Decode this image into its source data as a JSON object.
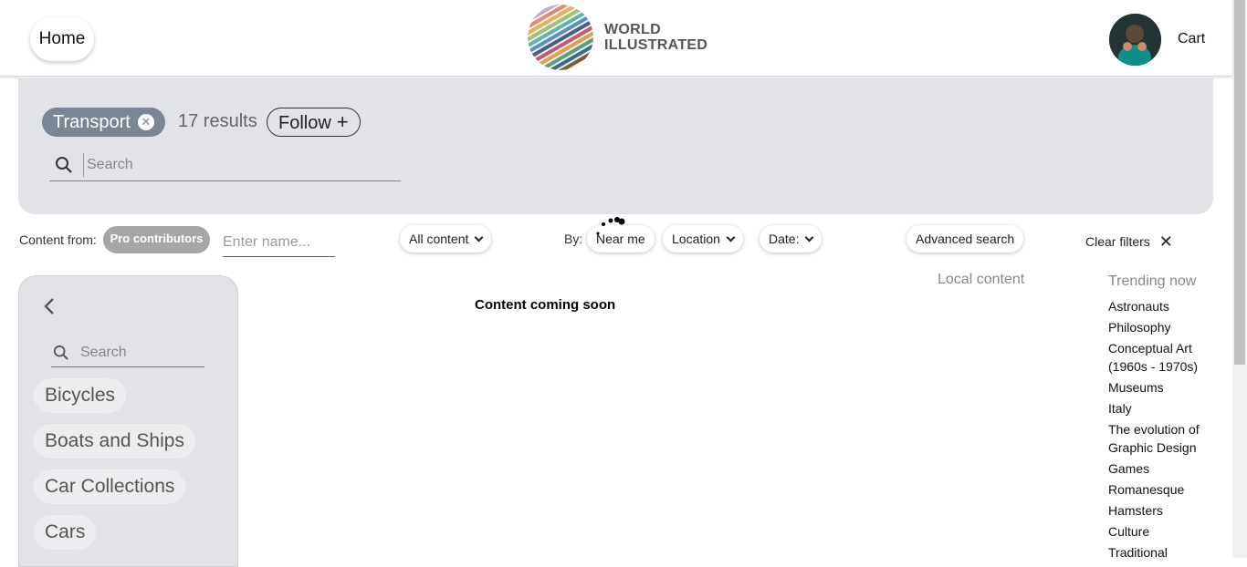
{
  "header": {
    "home_label": "Home",
    "logo_line1": "WORLD",
    "logo_line2": "ILLUSTRATED",
    "cart_label": "Cart"
  },
  "topic_panel": {
    "topic_label": "Transport",
    "results_text": "17 results",
    "follow_label": "Follow",
    "follow_icon": "+",
    "search_placeholder": "Search"
  },
  "filters": {
    "content_from_label": "Content from:",
    "pro_contributors_label": "Pro contributors",
    "name_placeholder": "Enter name...",
    "all_content_label": "All content",
    "by_label": "By:",
    "near_me_label": "Near me",
    "location_label": "Location",
    "date_label": "Date:",
    "advanced_search_label": "Advanced search",
    "clear_filters_label": "Clear filters",
    "clear_icon": "✕"
  },
  "sidebar": {
    "search_placeholder": "Search",
    "categories": [
      "Bicycles",
      "Boats and Ships",
      "Car Collections",
      "Cars"
    ]
  },
  "main": {
    "message": "Content coming soon",
    "local_content_label": "Local content"
  },
  "trending": {
    "title": "Trending now",
    "items": [
      "Astronauts",
      "Philosophy",
      "Conceptual Art (1960s - 1970s)",
      "Museums",
      "Italy",
      "The evolution of Graphic Design",
      "Games",
      "Romanesque",
      "Hamsters",
      "Culture",
      "Traditional"
    ]
  },
  "colors": {
    "panel_bg": "#e1e3e7",
    "topic_chip_bg": "#7b8596",
    "pro_chip_bg": "#a6a6a6",
    "muted_text": "#888888"
  }
}
